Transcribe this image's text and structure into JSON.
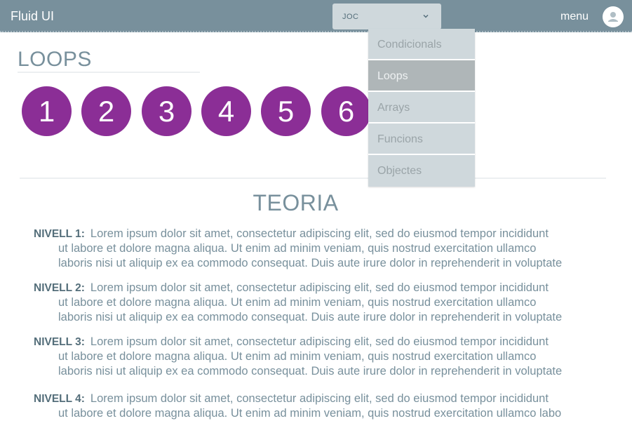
{
  "header": {
    "brand": "Fluid UI",
    "select_value": "JOC",
    "menu_label": "menu"
  },
  "dropdown": {
    "items": [
      {
        "label": "Condicionals",
        "active": false
      },
      {
        "label": "Loops",
        "active": true
      },
      {
        "label": "Arrays",
        "active": false
      },
      {
        "label": "Funcions",
        "active": false
      },
      {
        "label": "Objectes",
        "active": false
      }
    ]
  },
  "section": {
    "title": "LOOPS",
    "levels": [
      "1",
      "2",
      "3",
      "4",
      "5",
      "6"
    ]
  },
  "theory": {
    "title": "TEORIA",
    "entries": [
      {
        "label": "NIVELL 1:",
        "line1": "Lorem ipsum dolor sit amet, consectetur adipiscing elit, sed do eiusmod tempor incididunt",
        "line2": "ut labore et dolore magna aliqua. Ut enim ad minim veniam, quis nostrud exercitation ullamco",
        "line3": "laboris nisi ut aliquip ex ea commodo consequat. Duis aute irure dolor in reprehenderit in voluptate"
      },
      {
        "label": "NIVELL 2:",
        "line1": "Lorem ipsum dolor sit amet, consectetur adipiscing elit, sed do eiusmod tempor incididunt",
        "line2": "ut labore et dolore magna aliqua. Ut enim ad minim veniam, quis nostrud exercitation ullamco",
        "line3": "laboris nisi ut aliquip ex ea commodo consequat. Duis aute irure dolor in reprehenderit in voluptate"
      },
      {
        "label": "NIVELL 3:",
        "line1": "Lorem ipsum dolor sit amet, consectetur adipiscing elit, sed do eiusmod tempor incididunt",
        "line2": "ut labore et dolore magna aliqua. Ut enim ad minim veniam, quis nostrud exercitation ullamco",
        "line3": "laboris nisi ut aliquip ex ea commodo consequat. Duis aute irure dolor in reprehenderit in voluptate"
      },
      {
        "label": "NIVELL 4:",
        "line1": "Lorem ipsum dolor sit amet, consectetur adipiscing elit, sed do eiusmod tempor incididunt",
        "line2": "ut labore et dolore magna aliqua. Ut enim ad minim veniam, quis nostrud exercitation ullamco labo"
      }
    ]
  },
  "colors": {
    "topbar": "#78909c",
    "level_circle": "#8b2e96",
    "dropdown_bg": "#cfd8dc",
    "dropdown_active": "#afb6b8"
  },
  "icons": {
    "select_chevron": "chevron-down-icon",
    "avatar": "user-icon"
  }
}
